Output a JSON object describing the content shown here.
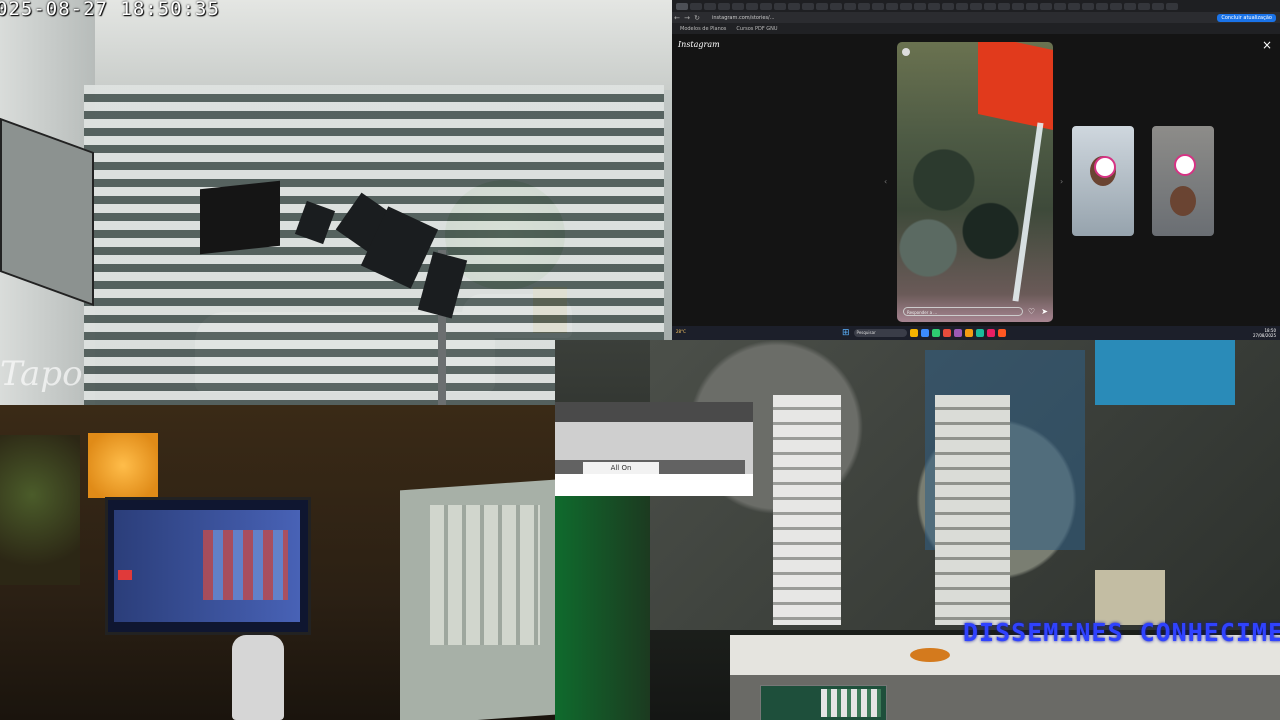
{
  "camera": {
    "timestamp": "025-08-27  18:50:35",
    "brand": "Tapo"
  },
  "browser": {
    "url": "instagram.com/stories/...",
    "bookmarks": [
      "Modelos de Planos",
      "Cursos PDF GNU"
    ],
    "signin_label": "Concluir atualização",
    "instagram": {
      "logo": "Instagram",
      "close": "×",
      "story_username": "",
      "reply_placeholder": "Responder a ...",
      "prev_arrow": "‹",
      "next_arrow": "›"
    },
    "taskbar": {
      "search": "Pesquisar",
      "time": "18:50",
      "date": "27/08/2025",
      "weather": "28°C"
    },
    "colors": {
      "story_accent": "#e13a1c",
      "taskbar_bg": "#1c1f2a"
    }
  },
  "overlay": {
    "all_on_label": "All On"
  },
  "studio": {
    "ticker": "DISSEMINES CONHECIMENTO"
  },
  "icons": {
    "back": "back-arrow-icon",
    "forward": "forward-arrow-icon",
    "reload": "reload-icon",
    "close": "close-icon",
    "like": "heart-icon",
    "share": "send-icon",
    "start": "windows-start-icon"
  }
}
